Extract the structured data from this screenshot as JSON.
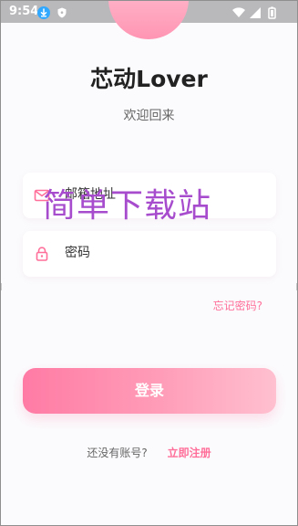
{
  "status_bar": {
    "time": "9:54"
  },
  "login": {
    "app_title": "芯动Lover",
    "subtitle": "欢迎回来",
    "email_value": "邮箱地址",
    "password_value": "密码",
    "forgot_password": "忘记密码?",
    "login_button": "登录",
    "register_prompt": "还没有账号?",
    "register_link": "立即注册"
  },
  "watermark": {
    "text": "简单下载站"
  },
  "colors": {
    "accent_pink": "#ff6f9a",
    "button_start": "#ff7ba5",
    "button_end": "#ffc0cf",
    "watermark_purple": "#a64ccd"
  },
  "icons": {
    "status_notification_1": "download-icon",
    "status_notification_2": "shield-icon",
    "wifi": "wifi-icon",
    "signal": "signal-icon",
    "battery": "battery-icon",
    "email": "mail-icon",
    "password": "lock-icon"
  }
}
